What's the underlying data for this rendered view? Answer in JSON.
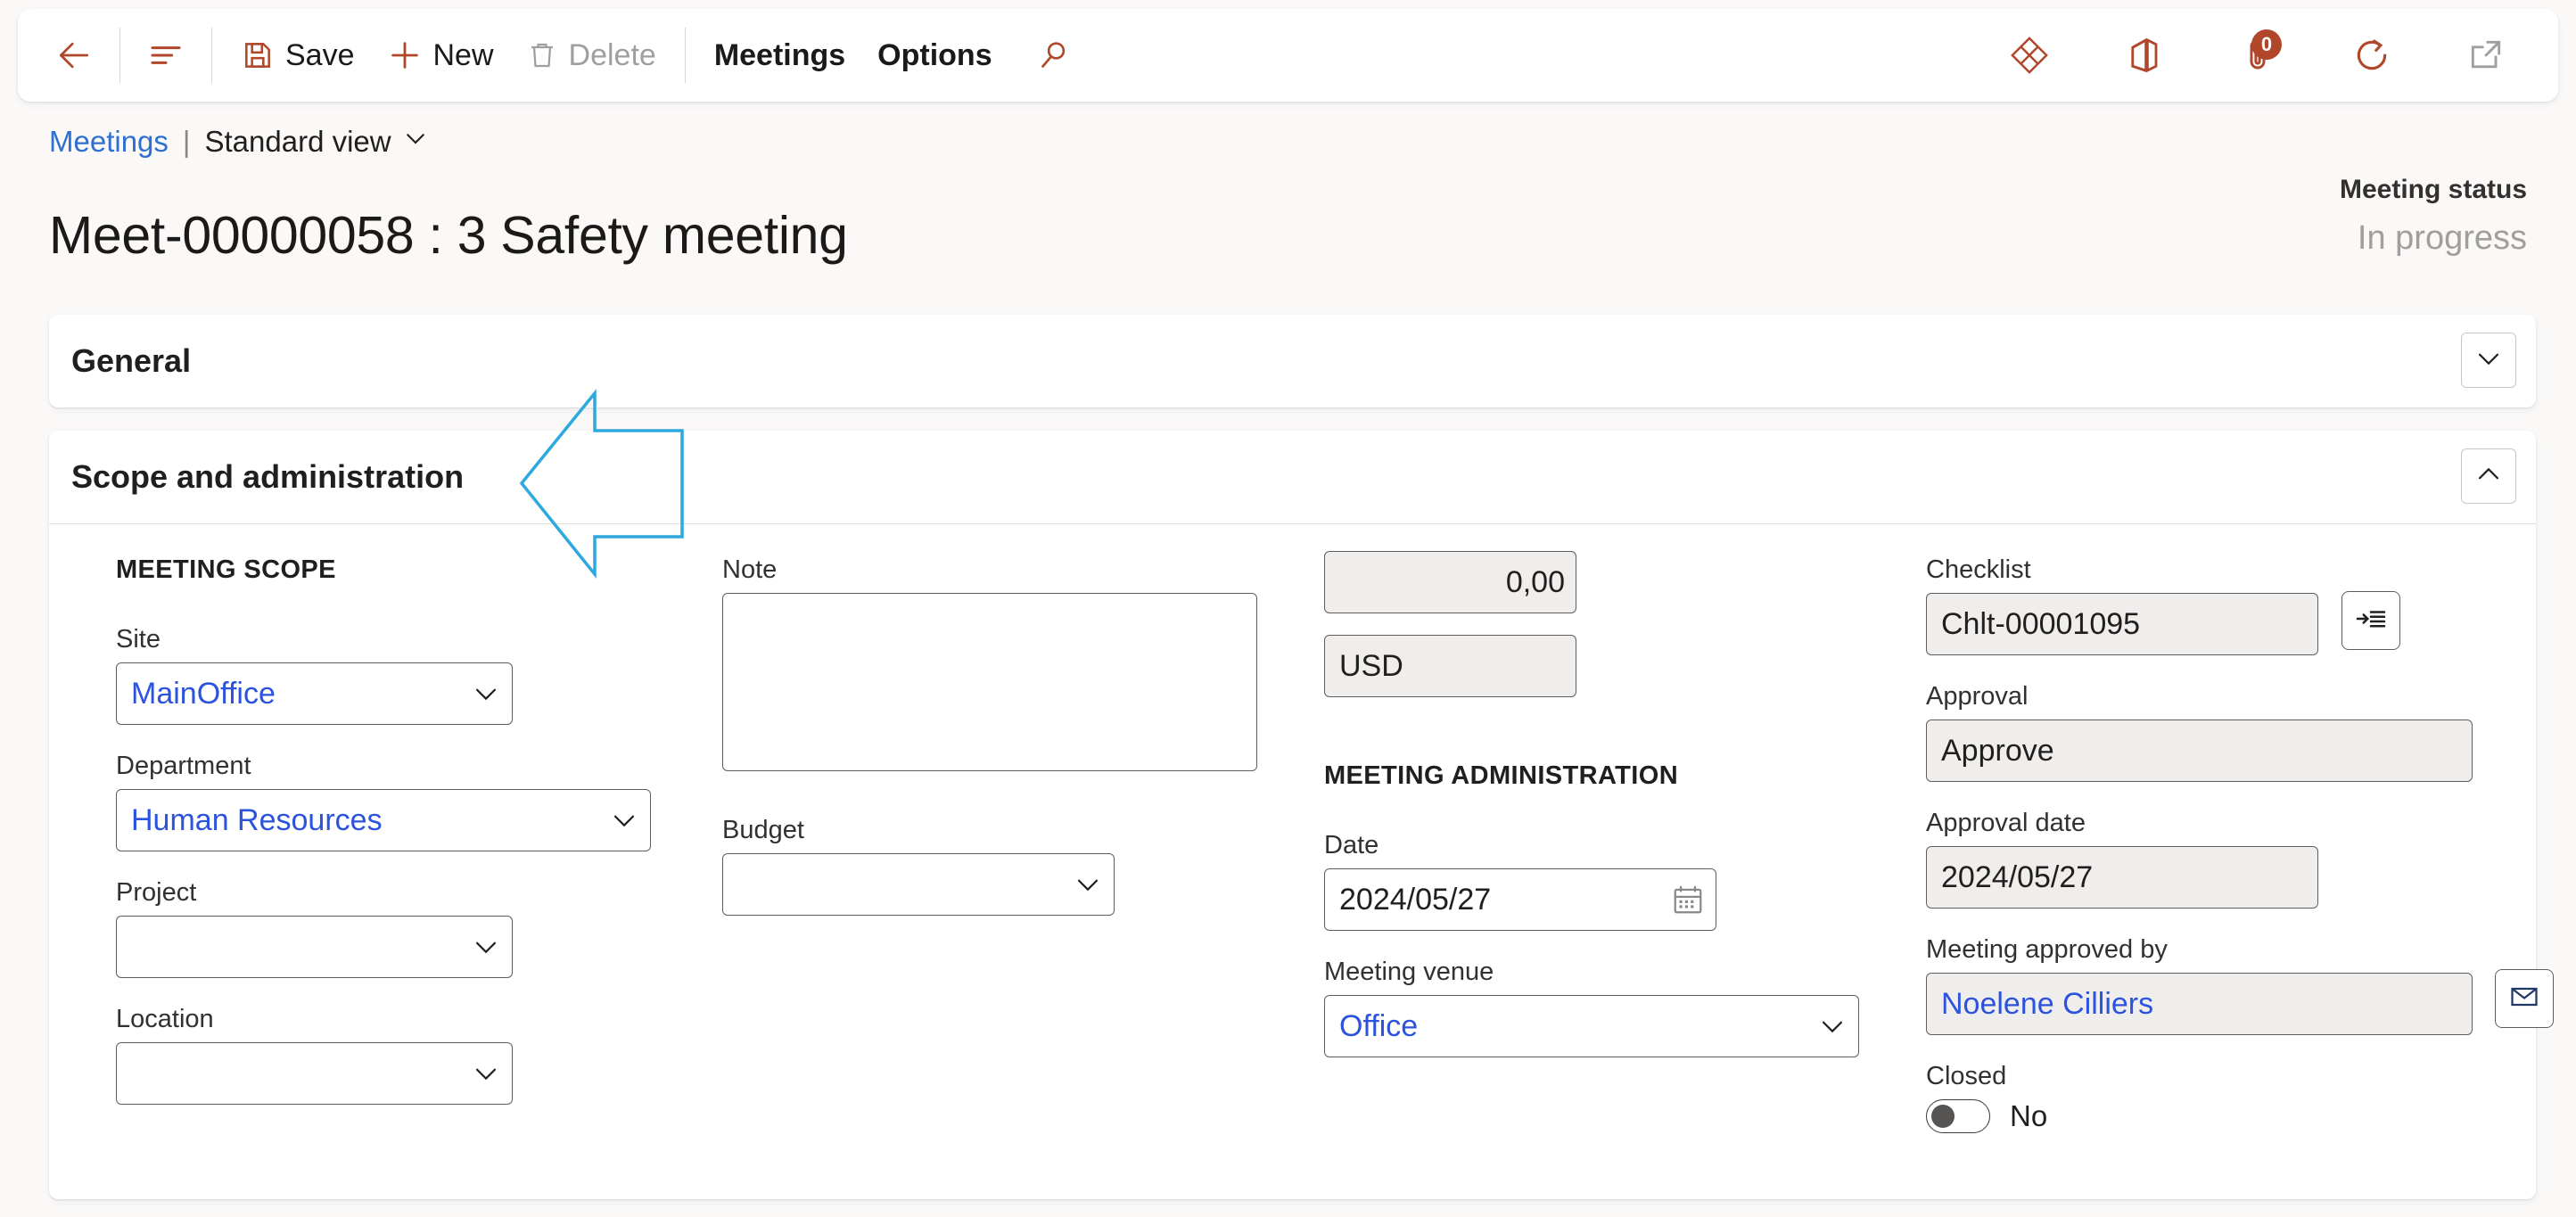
{
  "toolbar": {
    "back_label": "Back",
    "show_list_label": "Show list",
    "save_label": "Save",
    "new_label": "New",
    "delete_label": "Delete",
    "meetings_label": "Meetings",
    "options_label": "Options",
    "search_label": "Search",
    "attachments_count": "0",
    "icons": {
      "back": "back-arrow-icon",
      "list": "list-lines-icon",
      "save": "save-disk-icon",
      "new": "plus-icon",
      "delete": "trash-icon",
      "search": "search-icon",
      "dynamics": "dynamics-diamond-icon",
      "office": "office-icon",
      "attachments": "attachment-paperclip-icon",
      "refresh": "refresh-icon",
      "popout": "open-in-new-window-icon"
    }
  },
  "breadcrumb": {
    "parent": "Meetings",
    "separator": "|",
    "view": "Standard view"
  },
  "header": {
    "title": "Meet-00000058 : 3 Safety meeting",
    "status_label": "Meeting status",
    "status_value": "In progress"
  },
  "sections": {
    "general": {
      "title": "General",
      "expanded": false
    },
    "scope": {
      "title": "Scope and administration",
      "expanded": true
    }
  },
  "form": {
    "meeting_scope_heading": "MEETING SCOPE",
    "meeting_admin_heading": "MEETING ADMINISTRATION",
    "site": {
      "label": "Site",
      "value": "MainOffice"
    },
    "department": {
      "label": "Department",
      "value": "Human Resources"
    },
    "project": {
      "label": "Project",
      "value": ""
    },
    "location": {
      "label": "Location",
      "value": ""
    },
    "note": {
      "label": "Note",
      "value": ""
    },
    "budget": {
      "label": "Budget",
      "value": ""
    },
    "amount": {
      "label": "",
      "value": "0,00"
    },
    "currency": {
      "label": "",
      "value": "USD"
    },
    "date": {
      "label": "Date",
      "value": "2024/05/27"
    },
    "meeting_venue": {
      "label": "Meeting venue",
      "value": "Office"
    },
    "checklist": {
      "label": "Checklist",
      "value": "Chlt-00001095",
      "button": "go-to-details-icon"
    },
    "approval": {
      "label": "Approval",
      "value": "Approve"
    },
    "approval_date": {
      "label": "Approval date",
      "value": "2024/05/27"
    },
    "approved_by": {
      "label": "Meeting approved by",
      "value": "Noelene Cilliers",
      "button": "envelope-icon"
    },
    "closed": {
      "label": "Closed",
      "value": "No",
      "on": false
    }
  },
  "annotation": {
    "arrow": "left-pointing-callout-arrow",
    "color": "#2FA8E0"
  },
  "colors": {
    "accent": "#b0472b",
    "link": "#2f6fd0",
    "field_link": "#2b53dd",
    "page_bg": "#faf9f8",
    "card_bg": "#ffffff",
    "readonly_bg": "#efeeed",
    "border": "#605e5c"
  }
}
